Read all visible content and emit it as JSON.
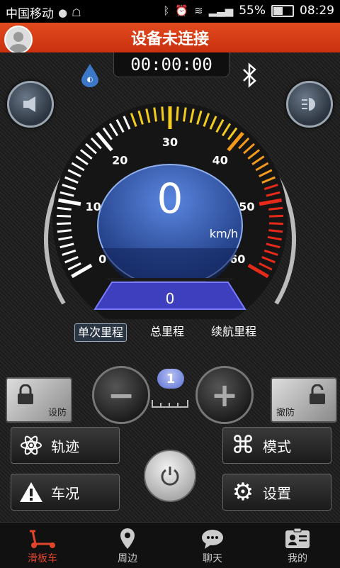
{
  "status_bar": {
    "carrier": "中国移动",
    "battery": "55%",
    "battery_level": 0.55,
    "time": "08:29"
  },
  "header": {
    "title": "设备未连接"
  },
  "timer": "00:00:00",
  "speedometer": {
    "speed": "0",
    "unit": "km/h",
    "ticks": [
      "0",
      "10",
      "20",
      "30",
      "40",
      "50",
      "60"
    ],
    "distance": "0"
  },
  "mileage_tabs": [
    {
      "label": "单次里程",
      "active": true
    },
    {
      "label": "总里程",
      "active": false
    },
    {
      "label": "续航里程",
      "active": false
    }
  ],
  "controls": {
    "arm_label": "设防",
    "disarm_label": "撤防",
    "level": "1"
  },
  "actions": {
    "track": "轨迹",
    "mode": "模式",
    "status": "车况",
    "settings": "设置"
  },
  "nav": [
    {
      "label": "滑板车",
      "icon": "scooter-icon",
      "active": true
    },
    {
      "label": "周边",
      "icon": "location-pin-icon",
      "active": false
    },
    {
      "label": "聊天",
      "icon": "chat-bubble-icon",
      "active": false
    },
    {
      "label": "我的",
      "icon": "id-card-icon",
      "active": false
    }
  ],
  "colors": {
    "header": "#d53a17",
    "accent_active": "#e0452a",
    "gauge_blue": "#2a4ea8"
  }
}
